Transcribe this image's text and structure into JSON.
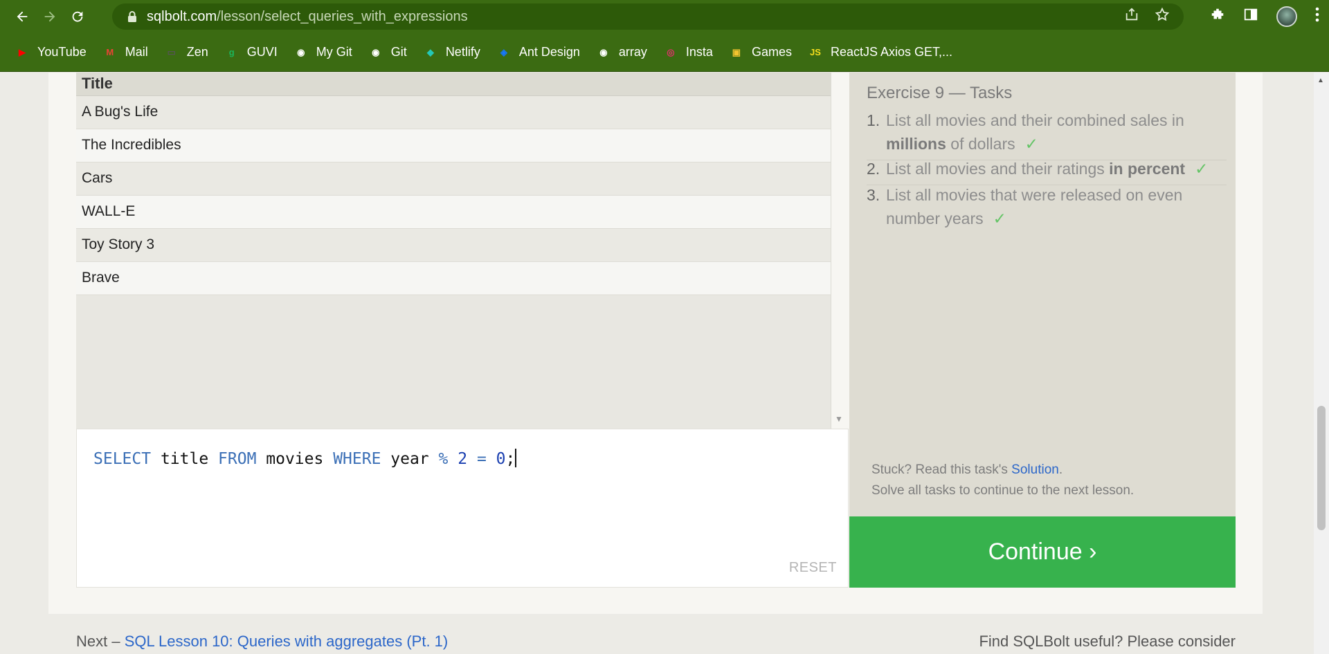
{
  "browser": {
    "url_host": "sqlbolt.com",
    "url_path": "/lesson/select_queries_with_expressions",
    "bookmarks": [
      {
        "label": "YouTube",
        "icon": "youtube-icon",
        "color": "#ff0000"
      },
      {
        "label": "Mail",
        "icon": "gmail-icon",
        "color": "#ea4335"
      },
      {
        "label": "Zen",
        "icon": "zen-icon",
        "color": "#555555"
      },
      {
        "label": "GUVI",
        "icon": "guvi-icon",
        "color": "#1bb55c"
      },
      {
        "label": "My Git",
        "icon": "github-icon",
        "color": "#ffffff"
      },
      {
        "label": "Git",
        "icon": "github-icon",
        "color": "#ffffff"
      },
      {
        "label": "Netlify",
        "icon": "netlify-icon",
        "color": "#25c7b7"
      },
      {
        "label": "Ant Design",
        "icon": "ant-design-icon",
        "color": "#1677ff"
      },
      {
        "label": "array",
        "icon": "github-icon",
        "color": "#ffffff"
      },
      {
        "label": "Insta",
        "icon": "instagram-icon",
        "color": "#e1306c"
      },
      {
        "label": "Games",
        "icon": "games-icon",
        "color": "#f4c430"
      },
      {
        "label": "ReactJS Axios GET,...",
        "icon": "js-icon",
        "color": "#f7df1e"
      }
    ]
  },
  "results": {
    "column_header": "Title",
    "rows": [
      "A Bug's Life",
      "The Incredibles",
      "Cars",
      "WALL-E",
      "Toy Story 3",
      "Brave"
    ]
  },
  "editor": {
    "query_tokens": [
      {
        "text": "SELECT",
        "type": "kw"
      },
      {
        "text": " title ",
        "type": "plain"
      },
      {
        "text": "FROM",
        "type": "kw"
      },
      {
        "text": " movies ",
        "type": "plain"
      },
      {
        "text": "WHERE",
        "type": "kw"
      },
      {
        "text": " year ",
        "type": "plain"
      },
      {
        "text": "%",
        "type": "kw"
      },
      {
        "text": " ",
        "type": "plain"
      },
      {
        "text": "2",
        "type": "num"
      },
      {
        "text": " = ",
        "type": "kw"
      },
      {
        "text": "0",
        "type": "num"
      },
      {
        "text": ";",
        "type": "plain"
      }
    ],
    "reset_label": "RESET"
  },
  "tasks": {
    "title": "Exercise 9 — Tasks",
    "items": [
      {
        "num": "1.",
        "pre": "List all movies and their combined sales in ",
        "bold": "millions",
        "post": " of dollars",
        "done": true
      },
      {
        "num": "2.",
        "pre": "List all movies and their ratings ",
        "bold": "in percent",
        "post": "",
        "done": true
      },
      {
        "num": "3.",
        "pre": "List all movies that were released on even number years",
        "bold": "",
        "post": "",
        "done": true
      }
    ],
    "check_mark": "✓",
    "stuck_text": "Stuck? Read this task's ",
    "solution_link": "Solution",
    "stuck_end": ".",
    "solve_all_text": "Solve all tasks to continue to the next lesson."
  },
  "continue_label": "Continue ›",
  "footer": {
    "next_prefix": "Next – ",
    "next_link": "SQL Lesson 10: Queries with aggregates (Pt. 1)",
    "right_text": "Find SQLBolt useful? Please consider"
  }
}
